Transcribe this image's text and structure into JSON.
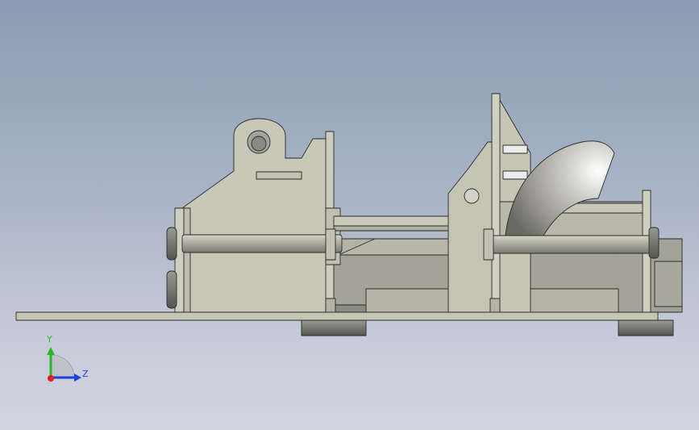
{
  "triad": {
    "y_label": "Y",
    "z_label": "Z",
    "y_color": "#2cb52c",
    "z_color": "#1f3fe0",
    "x_color": "#e01f1f"
  },
  "model": {
    "part_color": "#c4c4b4",
    "edge_color": "#2a2a2a",
    "shadow_color": "#6f6f69"
  }
}
